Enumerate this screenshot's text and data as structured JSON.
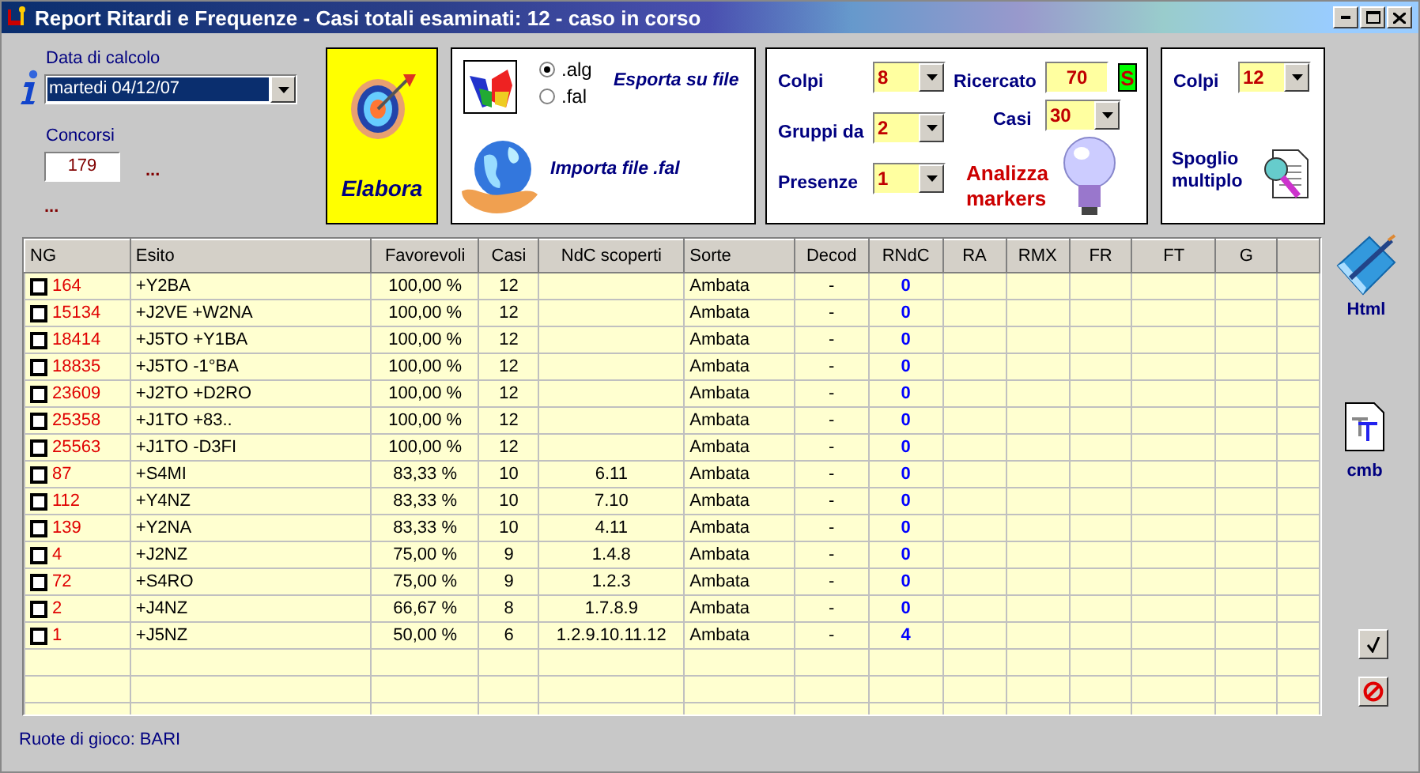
{
  "window": {
    "title": "Report Ritardi e Frequenze - Casi totali esaminati: 12 - caso in corso"
  },
  "date": {
    "label": "Data di calcolo",
    "value": "martedi 04/12/07"
  },
  "concorsi": {
    "label": "Concorsi",
    "value": "179",
    "more": [
      "...",
      "..."
    ]
  },
  "elabora": {
    "label": "Elabora"
  },
  "export": {
    "formats": [
      {
        "label": ".alg",
        "selected": true
      },
      {
        "label": ".fal",
        "selected": false
      }
    ],
    "export_label": "Esporta su file",
    "import_label": "Importa file .fal"
  },
  "markers": {
    "colpi": {
      "label": "Colpi",
      "value": "8"
    },
    "gruppi": {
      "label": "Gruppi da",
      "value": "2"
    },
    "presenze": {
      "label": "Presenze",
      "value": "1"
    },
    "ricercato": {
      "label": "Ricercato",
      "value": "70",
      "flag": "S"
    },
    "casi": {
      "label": "Casi",
      "value": "30"
    },
    "action": "Analizza markers"
  },
  "spoglio": {
    "colpi": {
      "label": "Colpi",
      "value": "12"
    },
    "action": "Spoglio multiplo"
  },
  "table": {
    "columns": [
      "NG",
      "Esito",
      "Favorevoli",
      "Casi",
      "NdC scoperti",
      "Sorte",
      "Decod",
      "RNdC",
      "RA",
      "RMX",
      "FR",
      "FT",
      "G"
    ],
    "rows": [
      {
        "checked": false,
        "ng": "164",
        "esito": "+Y2BA",
        "favorevoli": "100,00 %",
        "casi": "12",
        "ndc": "",
        "sorte": "Ambata",
        "decod": "-",
        "rndc": "0"
      },
      {
        "checked": false,
        "ng": "15134",
        "esito": "+J2VE +W2NA",
        "favorevoli": "100,00 %",
        "casi": "12",
        "ndc": "",
        "sorte": "Ambata",
        "decod": "-",
        "rndc": "0"
      },
      {
        "checked": false,
        "ng": "18414",
        "esito": "+J5TO +Y1BA",
        "favorevoli": "100,00 %",
        "casi": "12",
        "ndc": "",
        "sorte": "Ambata",
        "decod": "-",
        "rndc": "0"
      },
      {
        "checked": false,
        "ng": "18835",
        "esito": "+J5TO -1°BA",
        "favorevoli": "100,00 %",
        "casi": "12",
        "ndc": "",
        "sorte": "Ambata",
        "decod": "-",
        "rndc": "0"
      },
      {
        "checked": false,
        "ng": "23609",
        "esito": "+J2TO +D2RO",
        "favorevoli": "100,00 %",
        "casi": "12",
        "ndc": "",
        "sorte": "Ambata",
        "decod": "-",
        "rndc": "0"
      },
      {
        "checked": false,
        "ng": "25358",
        "esito": "+J1TO +83..",
        "favorevoli": "100,00 %",
        "casi": "12",
        "ndc": "",
        "sorte": "Ambata",
        "decod": "-",
        "rndc": "0"
      },
      {
        "checked": false,
        "ng": "25563",
        "esito": "+J1TO -D3FI",
        "favorevoli": "100,00 %",
        "casi": "12",
        "ndc": "",
        "sorte": "Ambata",
        "decod": "-",
        "rndc": "0"
      },
      {
        "checked": false,
        "ng": "87",
        "esito": "+S4MI",
        "favorevoli": "83,33 %",
        "casi": "10",
        "ndc": "6.11",
        "sorte": "Ambata",
        "decod": "-",
        "rndc": "0"
      },
      {
        "checked": false,
        "ng": "112",
        "esito": "+Y4NZ",
        "favorevoli": "83,33 %",
        "casi": "10",
        "ndc": "7.10",
        "sorte": "Ambata",
        "decod": "-",
        "rndc": "0"
      },
      {
        "checked": false,
        "ng": "139",
        "esito": "+Y2NA",
        "favorevoli": "83,33 %",
        "casi": "10",
        "ndc": "4.11",
        "sorte": "Ambata",
        "decod": "-",
        "rndc": "0"
      },
      {
        "checked": false,
        "ng": "4",
        "esito": "+J2NZ",
        "favorevoli": "75,00 %",
        "casi": "9",
        "ndc": "1.4.8",
        "sorte": "Ambata",
        "decod": "-",
        "rndc": "0"
      },
      {
        "checked": false,
        "ng": "72",
        "esito": "+S4RO",
        "favorevoli": "75,00 %",
        "casi": "9",
        "ndc": "1.2.3",
        "sorte": "Ambata",
        "decod": "-",
        "rndc": "0"
      },
      {
        "checked": false,
        "ng": "2",
        "esito": "+J4NZ",
        "favorevoli": "66,67 %",
        "casi": "8",
        "ndc": "1.7.8.9",
        "sorte": "Ambata",
        "decod": "-",
        "rndc": "0"
      },
      {
        "checked": false,
        "ng": "1",
        "esito": "+J5NZ",
        "favorevoli": "50,00 %",
        "casi": "6",
        "ndc": "1.2.9.10.11.12",
        "sorte": "Ambata",
        "decod": "-",
        "rndc": "4"
      }
    ]
  },
  "side": {
    "html_label": "Html",
    "cmb_label": "cmb"
  },
  "status": "Ruote di gioco: BARI"
}
